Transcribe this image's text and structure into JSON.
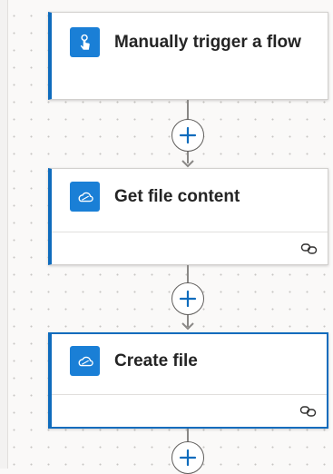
{
  "flow": {
    "steps": [
      {
        "title": "Manually trigger a flow",
        "icon": "touch-trigger-icon",
        "has_footer": false
      },
      {
        "title": "Get file content",
        "icon": "onedrive-cloud-icon",
        "has_footer": true
      },
      {
        "title": "Create file",
        "icon": "onedrive-cloud-icon",
        "has_footer": true
      }
    ],
    "add_step_icon": "plus-icon",
    "link_icon": "connection-link-icon"
  },
  "colors": {
    "accent": "#0f6cbd",
    "icon_tile": "#1a7fd6",
    "canvas": "#faf9f8",
    "connector": "#8a8886"
  }
}
